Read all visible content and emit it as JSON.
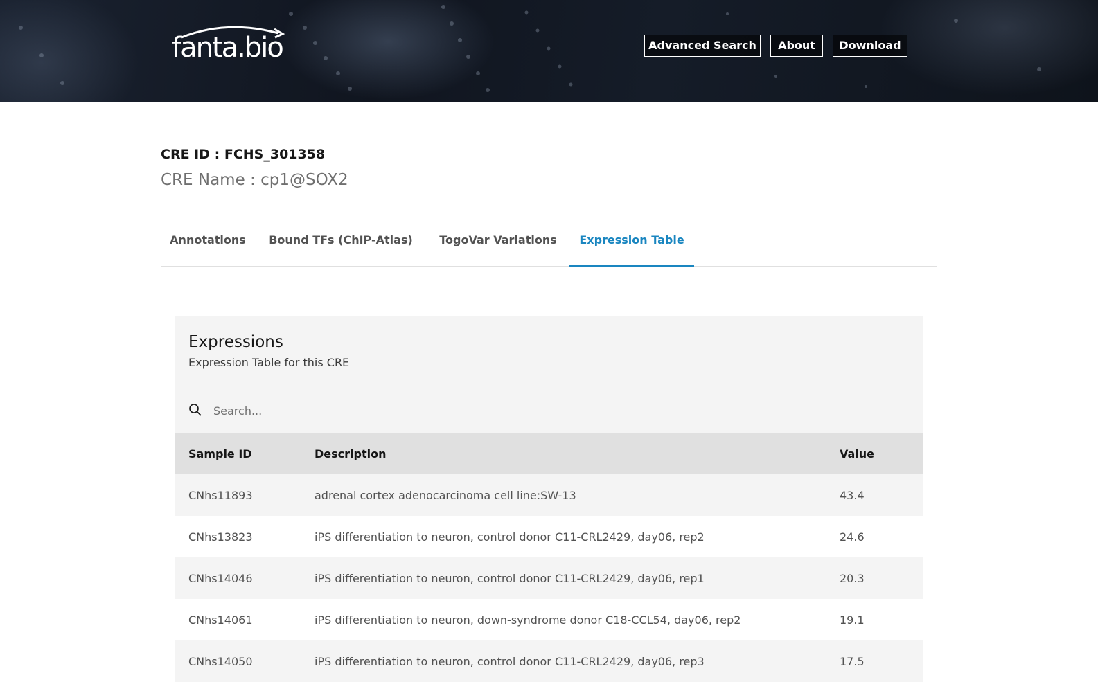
{
  "header": {
    "logo_text": "fanta.bio",
    "nav": [
      {
        "label": "Advanced Search"
      },
      {
        "label": "About"
      },
      {
        "label": "Download"
      }
    ]
  },
  "cre": {
    "id_line": "CRE ID : FCHS_301358",
    "name_line": "CRE Name : cp1@SOX2"
  },
  "tabs": [
    {
      "label": "Annotations",
      "active": false
    },
    {
      "label": "Bound TFs (ChIP-Atlas)",
      "active": false
    },
    {
      "label": "TogoVar Variations",
      "active": false
    },
    {
      "label": "Expression Table",
      "active": true
    }
  ],
  "expressions": {
    "title": "Expressions",
    "subtitle": "Expression Table for this CRE",
    "search_placeholder": "Search...",
    "columns": [
      "Sample ID",
      "Description",
      "Value"
    ],
    "rows": [
      {
        "sample_id": "CNhs11893",
        "description": "adrenal cortex adenocarcinoma cell line:SW-13",
        "value": "43.4"
      },
      {
        "sample_id": "CNhs13823",
        "description": "iPS differentiation to neuron, control donor C11-CRL2429, day06, rep2",
        "value": "24.6"
      },
      {
        "sample_id": "CNhs14046",
        "description": "iPS differentiation to neuron, control donor C11-CRL2429, day06, rep1",
        "value": "20.3"
      },
      {
        "sample_id": "CNhs14061",
        "description": "iPS differentiation to neuron, down-syndrome donor C18-CCL54, day06, rep2",
        "value": "19.1"
      },
      {
        "sample_id": "CNhs14050",
        "description": "iPS differentiation to neuron, control donor C11-CRL2429, day06, rep3",
        "value": "17.5"
      }
    ]
  },
  "colors": {
    "accent": "#1a86c0",
    "header_bg": "#10151f"
  }
}
